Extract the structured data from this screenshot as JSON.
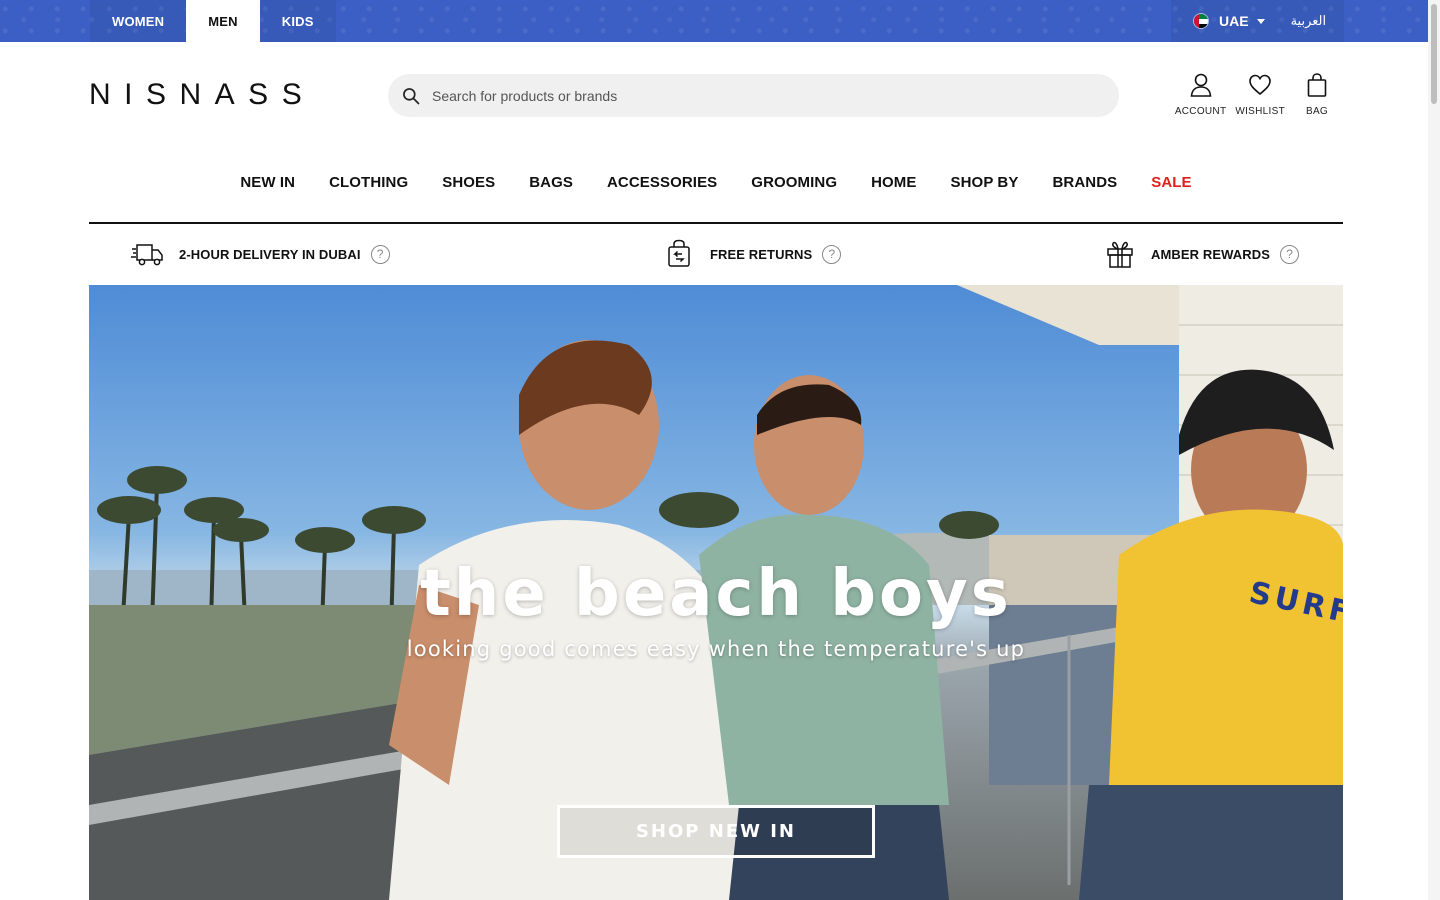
{
  "gender_tabs": [
    {
      "label": "WOMEN",
      "active": false
    },
    {
      "label": "MEN",
      "active": true
    },
    {
      "label": "KIDS",
      "active": false
    }
  ],
  "region": {
    "country": "UAE",
    "language": "العربية",
    "flag": "uae-flag-icon"
  },
  "logo": "NISNASS",
  "search": {
    "placeholder": "Search for products or brands",
    "value": ""
  },
  "header_actions": [
    {
      "label": "ACCOUNT",
      "icon": "user-icon"
    },
    {
      "label": "WISHLIST",
      "icon": "heart-icon"
    },
    {
      "label": "BAG",
      "icon": "shopping-bag-icon"
    }
  ],
  "nav": [
    "NEW IN",
    "CLOTHING",
    "SHOES",
    "BAGS",
    "ACCESSORIES",
    "GROOMING",
    "HOME",
    "SHOP BY",
    "BRANDS",
    "SALE"
  ],
  "benefits": [
    {
      "label": "2-HOUR DELIVERY IN DUBAI",
      "icon": "delivery-truck-icon"
    },
    {
      "label": "FREE RETURNS",
      "icon": "return-bag-icon"
    },
    {
      "label": "AMBER REWARDS",
      "icon": "gift-icon"
    }
  ],
  "hero": {
    "title": "the beach boys",
    "subtitle": "looking good comes easy when the temperature's up",
    "cta": "SHOP NEW IN",
    "shirt_text": "SURF"
  },
  "colors": {
    "topbar": "#3b5fc4",
    "sale": "#e0201b",
    "text": "#111111"
  }
}
